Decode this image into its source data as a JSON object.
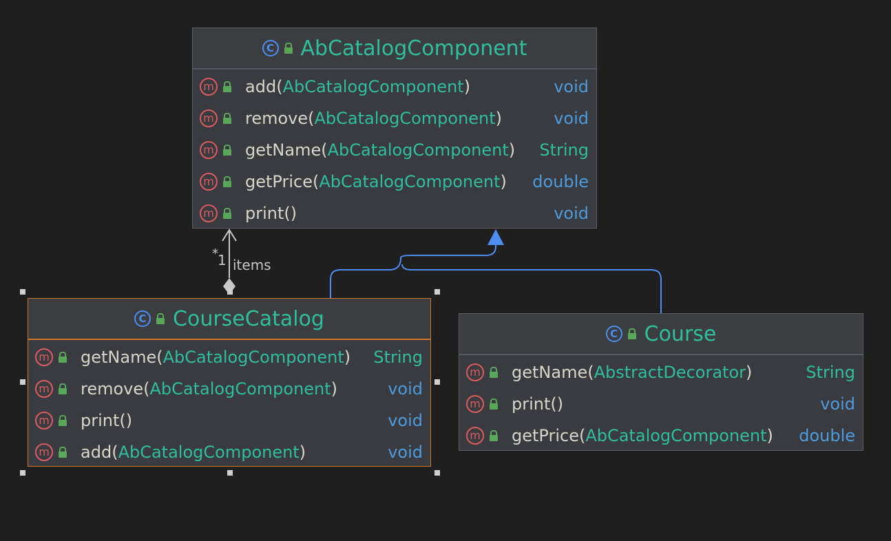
{
  "diagram": {
    "nodes": [
      {
        "id": "abcatalogcomponent",
        "title": "AbCatalogComponent",
        "methods": [
          {
            "name": "add",
            "param": "AbCatalogComponent",
            "ret": "void"
          },
          {
            "name": "remove",
            "param": "AbCatalogComponent",
            "ret": "void"
          },
          {
            "name": "getName",
            "param": "AbCatalogComponent",
            "ret": "String"
          },
          {
            "name": "getPrice",
            "param": "AbCatalogComponent",
            "ret": "double"
          },
          {
            "name": "print",
            "param": "",
            "ret": "void"
          }
        ]
      },
      {
        "id": "coursecatalog",
        "title": "CourseCatalog",
        "selected": true,
        "methods": [
          {
            "name": "getName",
            "param": "AbCatalogComponent",
            "ret": "String"
          },
          {
            "name": "remove",
            "param": "AbCatalogComponent",
            "ret": "void"
          },
          {
            "name": "print",
            "param": "",
            "ret": "void"
          },
          {
            "name": "add",
            "param": "AbCatalogComponent",
            "ret": "void"
          }
        ]
      },
      {
        "id": "course",
        "title": "Course",
        "methods": [
          {
            "name": "getName",
            "param": "AbstractDecorator",
            "ret": "String"
          },
          {
            "name": "print",
            "param": "",
            "ret": "void"
          },
          {
            "name": "getPrice",
            "param": "AbCatalogComponent",
            "ret": "double"
          }
        ]
      }
    ],
    "edges": {
      "composition": {
        "from": "coursecatalog",
        "to": "abcatalogcomponent",
        "role": "items",
        "multiplicity_star": "*",
        "multiplicity_one": "1"
      },
      "generalization": {
        "from": [
          "coursecatalog",
          "course"
        ],
        "to": "abcatalogcomponent"
      }
    },
    "icons": {
      "class_icon": "class-icon",
      "class_glyph": "C",
      "method_icon": "method-icon",
      "method_glyph": "m",
      "visibility_icon": "public-lock-icon"
    },
    "colors": {
      "background": "#1f1f1f",
      "node_fill": "#393b40",
      "node_border": "#5d5f63",
      "selected_border": "#c9772c",
      "title": "#2fbf9c",
      "method_name": "#d8d6c9",
      "param_type": "#2fbf9c",
      "void": "#4d9bdc",
      "class_icon": "#4d8ef0",
      "method_icon": "#db5c5c",
      "lock": "#59a85a",
      "generalization_edge": "#4d8ef0",
      "composition_edge": "#c8c8c8"
    }
  }
}
